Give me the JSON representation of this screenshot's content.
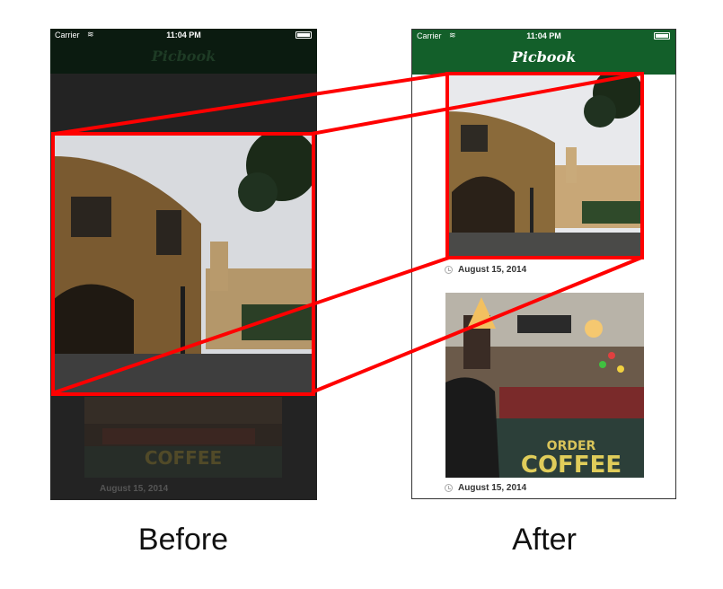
{
  "before_phone": {
    "status": {
      "carrier": "Carrier",
      "time": "11:04 PM"
    },
    "nav_title": "Picbook",
    "date": "August 15, 2014"
  },
  "after_phone": {
    "status": {
      "carrier": "Carrier",
      "time": "11:04 PM"
    },
    "nav_title": "Picbook",
    "posts": [
      {
        "date": "August 15, 2014",
        "icon": "clock-icon"
      },
      {
        "date": "August 15, 2014",
        "icon": "clock-icon"
      }
    ]
  },
  "captions": {
    "before": "Before",
    "after": "After"
  },
  "colors": {
    "highlight": "#ff0000",
    "nav_green": "#135f2a"
  }
}
